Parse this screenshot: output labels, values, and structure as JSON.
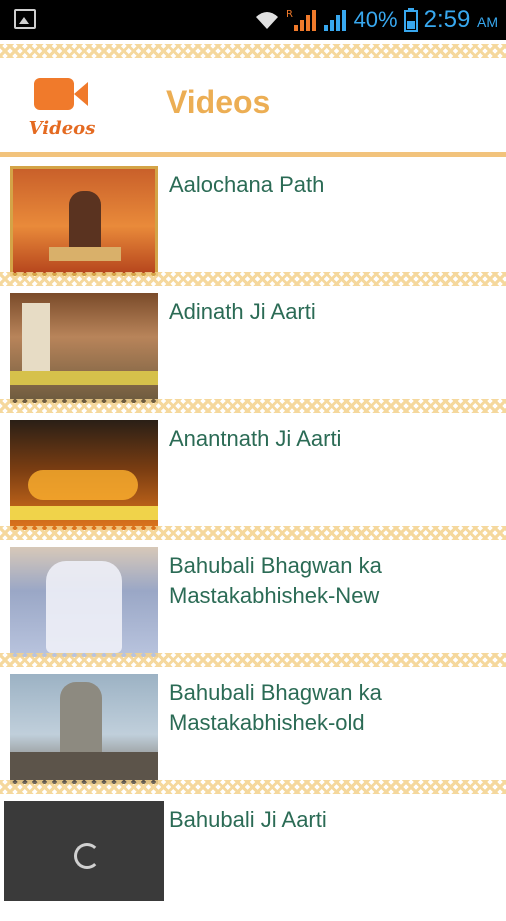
{
  "status_bar": {
    "battery": "40%",
    "time": "2:59",
    "ampm": "AM",
    "roaming": "R"
  },
  "header": {
    "icon_label": "Videos",
    "title": "Videos"
  },
  "videos": [
    {
      "title": "Aalochana Path"
    },
    {
      "title": "Adinath Ji Aarti"
    },
    {
      "title": "Anantnath Ji Aarti"
    },
    {
      "title": "Bahubali Bhagwan ka Mastakabhishek-New"
    },
    {
      "title": "Bahubali Bhagwan ka Mastakabhishek-old"
    },
    {
      "title": "Bahubali Ji Aarti"
    }
  ],
  "colors": {
    "accent": "#f07a2b",
    "title": "#ecae54",
    "item_text": "#2b6b55",
    "status": "#38a8ef"
  }
}
